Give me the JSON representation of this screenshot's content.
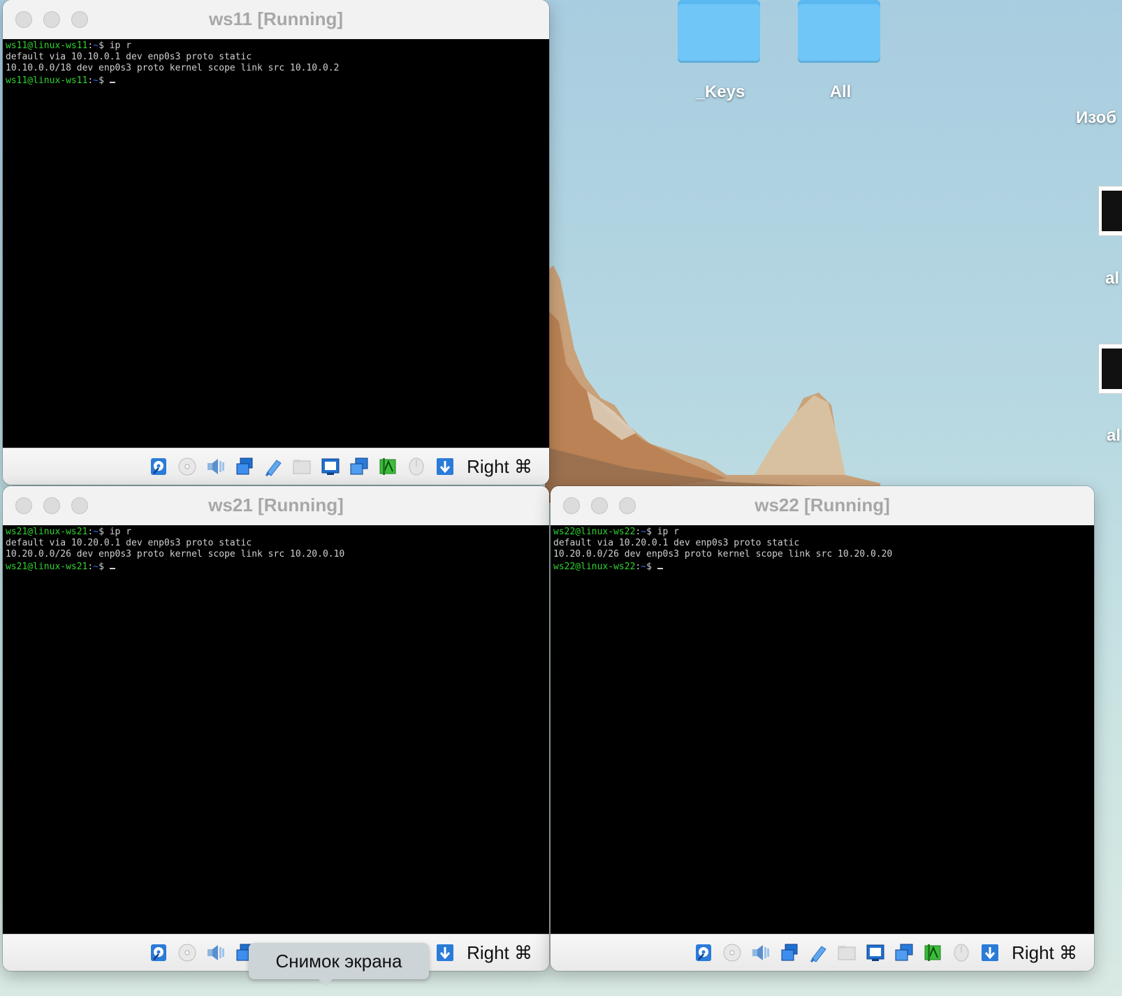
{
  "desktop": {
    "folders": [
      {
        "label": "_Keys"
      },
      {
        "label": "All"
      }
    ],
    "edge_labels": [
      "Изоб",
      "al",
      "al"
    ]
  },
  "host_key_label": "Right ⌘",
  "windows": [
    {
      "title": "ws11 [Running]",
      "lines": [
        {
          "user": "ws11@linux-ws11",
          "path": "~",
          "rest": "$ ip r"
        },
        {
          "text": "default via 10.10.0.1 dev enp0s3 proto static"
        },
        {
          "text": "10.10.0.0/18 dev enp0s3 proto kernel scope link src 10.10.0.2"
        },
        {
          "user": "ws11@linux-ws11",
          "path": "~",
          "rest": "$ "
        }
      ]
    },
    {
      "title": "ws21 [Running]",
      "lines": [
        {
          "user": "ws21@linux-ws21",
          "path": "~",
          "rest": "$ ip r"
        },
        {
          "text": "default via 10.20.0.1 dev enp0s3 proto static"
        },
        {
          "text": "10.20.0.0/26 dev enp0s3 proto kernel scope link src 10.20.0.10"
        },
        {
          "user": "ws21@linux-ws21",
          "path": "~",
          "rest": "$ "
        }
      ]
    },
    {
      "title": "ws22 [Running]",
      "lines": [
        {
          "user": "ws22@linux-ws22",
          "path": "~",
          "rest": "$ ip r"
        },
        {
          "text": "default via 10.20.0.1 dev enp0s3 proto static"
        },
        {
          "text": "10.20.0.0/26 dev enp0s3 proto kernel scope link src 10.20.0.20"
        },
        {
          "user": "ws22@linux-ws22",
          "path": "~",
          "rest": "$ "
        }
      ]
    }
  ],
  "status_icons": [
    "hard-disk-icon",
    "optical-disc-icon",
    "audio-icon",
    "network-icon",
    "usb-icon",
    "shared-folder-icon",
    "display-icon",
    "screen-capture-icon",
    "recording-icon",
    "mouse-integration-icon",
    "arrow-down-icon"
  ],
  "tooltip": {
    "text": "Снимок экрана"
  },
  "colors": {
    "prompt_user": "#2fd32f",
    "prompt_path": "#3a6bff",
    "folder": "#6fc6f7"
  }
}
